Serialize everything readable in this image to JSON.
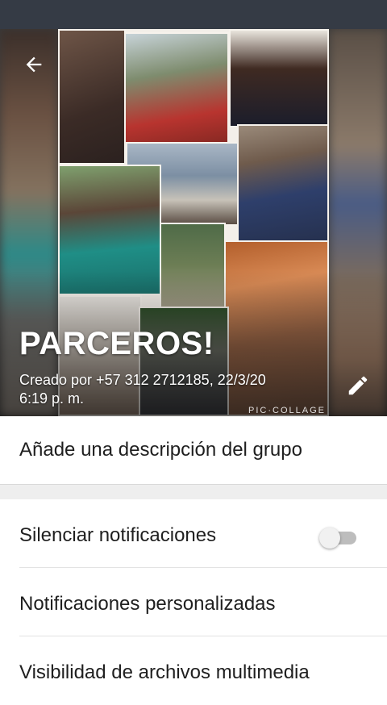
{
  "header": {
    "group_name": "PARCEROS!",
    "created_line1": "Creado por +57 312 2712185, 22/3/20",
    "created_line2": "6:19 p. m.",
    "watermark": "PIC·COLLAGE"
  },
  "icons": {
    "back": "arrow-back-icon",
    "edit": "pencil-edit-icon"
  },
  "description": {
    "label": "Añade una descripción del grupo"
  },
  "settings": [
    {
      "label": "Silenciar notificaciones",
      "toggle": false
    },
    {
      "label": "Notificaciones personalizadas"
    },
    {
      "label": "Visibilidad de archivos multimedia"
    }
  ],
  "colors": {
    "status_bar": "#353b45",
    "text_primary": "#1f1f1f",
    "divider": "#eeeeee"
  }
}
